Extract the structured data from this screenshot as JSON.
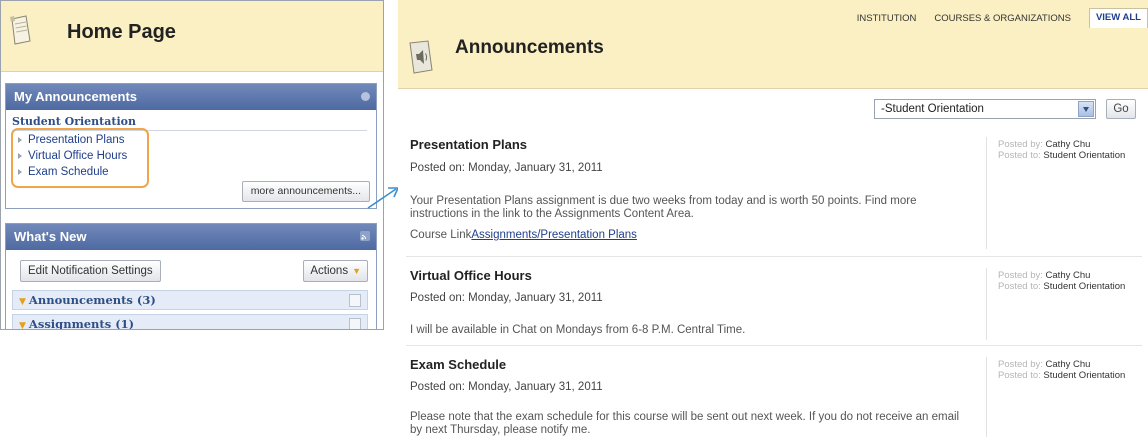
{
  "left_panel": {
    "title": "Home Page",
    "my_announcements": {
      "header": "My Announcements",
      "course": "Student Orientation",
      "items": [
        "Presentation Plans",
        "Virtual Office Hours",
        "Exam Schedule"
      ],
      "more_label": "more announcements..."
    },
    "whats_new": {
      "header": "What's New",
      "edit_label": "Edit Notification Settings",
      "actions_label": "Actions",
      "categories": [
        "Announcements (3)",
        "Assignments (1)"
      ]
    }
  },
  "right_panel": {
    "tabs": [
      "INSTITUTION",
      "COURSES & ORGANIZATIONS",
      "VIEW ALL"
    ],
    "title": "Announcements",
    "filter": {
      "selected": "-Student Orientation",
      "go_label": "Go"
    },
    "posts": [
      {
        "title": "Presentation Plans",
        "date": "Posted on: Monday, January 31, 2011",
        "body": "Your Presentation Plans assignment is due two weeks from today and is worth 50 points. Find more instructions in the link to the Assignments Content Area.",
        "link_prefix": "Course Link",
        "link_text": "Assignments/Presentation Plans",
        "posted_by_label": "Posted by:",
        "posted_by": "Cathy Chu",
        "posted_to_label": "Posted to:",
        "posted_to": "Student Orientation"
      },
      {
        "title": "Virtual Office Hours",
        "date": "Posted on: Monday, January 31, 2011",
        "body": "I will be available in Chat on Mondays from 6-8 P.M. Central Time.",
        "posted_by_label": "Posted by:",
        "posted_by": "Cathy Chu",
        "posted_to_label": "Posted to:",
        "posted_to": "Student Orientation"
      },
      {
        "title": "Exam Schedule",
        "date": "Posted on: Monday, January 31, 2011",
        "body": "Please note that the exam schedule for this course will be sent out next week. If you do not receive an email by next Thursday, please notify me.",
        "posted_by_label": "Posted by:",
        "posted_by": "Cathy Chu",
        "posted_to_label": "Posted to:",
        "posted_to": "Student Orientation"
      }
    ]
  },
  "colors": {
    "header_bg": "#faf0c4",
    "module_header": "#5a74aa",
    "link": "#1f3f8c",
    "highlight": "#f0a54a",
    "arrow": "#3d8fd1"
  },
  "icons": [
    "page-icon",
    "speaker-icon",
    "bullet-arrow-icon",
    "callout-arrow-icon",
    "rss-icon",
    "chevron-down-icon"
  ]
}
